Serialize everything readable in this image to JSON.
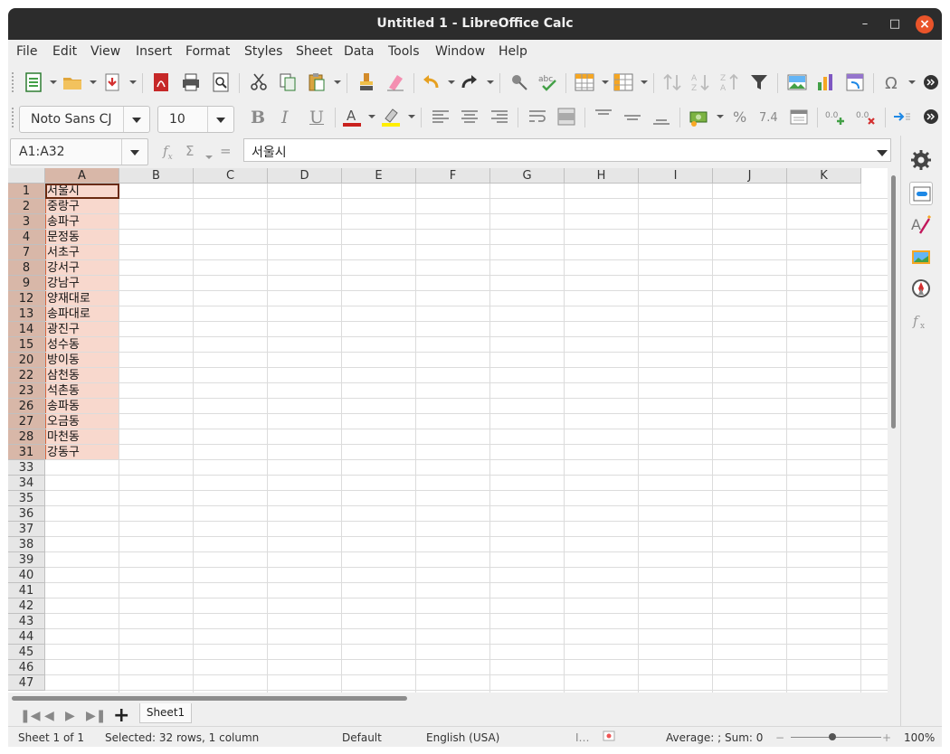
{
  "window": {
    "title": "Untitled 1 - LibreOffice Calc"
  },
  "menu": [
    "File",
    "Edit",
    "View",
    "Insert",
    "Format",
    "Styles",
    "Sheet",
    "Data",
    "Tools",
    "Window",
    "Help"
  ],
  "font": {
    "name": "Noto Sans CJ",
    "size": "10"
  },
  "formula_bar": {
    "name_box": "A1:A32",
    "content": "서울시",
    "sigma": "Σ",
    "equals": "="
  },
  "columns": [
    "A",
    "B",
    "C",
    "D",
    "E",
    "F",
    "G",
    "H",
    "I",
    "J",
    "K"
  ],
  "rows": [
    {
      "n": "1",
      "a": "서울시"
    },
    {
      "n": "2",
      "a": "중랑구"
    },
    {
      "n": "3",
      "a": "송파구"
    },
    {
      "n": "4",
      "a": "문정동"
    },
    {
      "n": "7",
      "a": "서초구"
    },
    {
      "n": "8",
      "a": "강서구"
    },
    {
      "n": "9",
      "a": "강남구"
    },
    {
      "n": "12",
      "a": "양재대로"
    },
    {
      "n": "13",
      "a": "송파대로"
    },
    {
      "n": "14",
      "a": "광진구"
    },
    {
      "n": "15",
      "a": "성수동"
    },
    {
      "n": "20",
      "a": "방이동"
    },
    {
      "n": "22",
      "a": "삼천동"
    },
    {
      "n": "23",
      "a": "석촌동"
    },
    {
      "n": "26",
      "a": "송파동"
    },
    {
      "n": "27",
      "a": "오금동"
    },
    {
      "n": "28",
      "a": "마천동"
    },
    {
      "n": "31",
      "a": "강동구"
    },
    {
      "n": "33",
      "a": ""
    },
    {
      "n": "34",
      "a": ""
    },
    {
      "n": "35",
      "a": ""
    },
    {
      "n": "36",
      "a": ""
    },
    {
      "n": "37",
      "a": ""
    },
    {
      "n": "38",
      "a": ""
    },
    {
      "n": "39",
      "a": ""
    },
    {
      "n": "40",
      "a": ""
    },
    {
      "n": "41",
      "a": ""
    },
    {
      "n": "42",
      "a": ""
    },
    {
      "n": "43",
      "a": ""
    },
    {
      "n": "44",
      "a": ""
    },
    {
      "n": "45",
      "a": ""
    },
    {
      "n": "46",
      "a": ""
    },
    {
      "n": "47",
      "a": ""
    }
  ],
  "sheet_tabs": [
    "Sheet1"
  ],
  "status": {
    "sheet": "Sheet 1 of 1",
    "selection": "Selected: 32 rows, 1 column",
    "style": "Default",
    "language": "English (USA)",
    "sum": "Average: ; Sum: 0",
    "zoom": "100%",
    "zoom_minus": "−",
    "zoom_plus": "+"
  },
  "colors": {
    "titlebar": "#2c2c2c",
    "selection_fill": "#f6cdbd",
    "selection_border": "#d9663c",
    "close_button": "#e9542a"
  },
  "icons": {
    "sidebar": [
      "properties-icon",
      "styles-icon",
      "gallery-icon",
      "navigator-icon",
      "functions-icon"
    ]
  }
}
